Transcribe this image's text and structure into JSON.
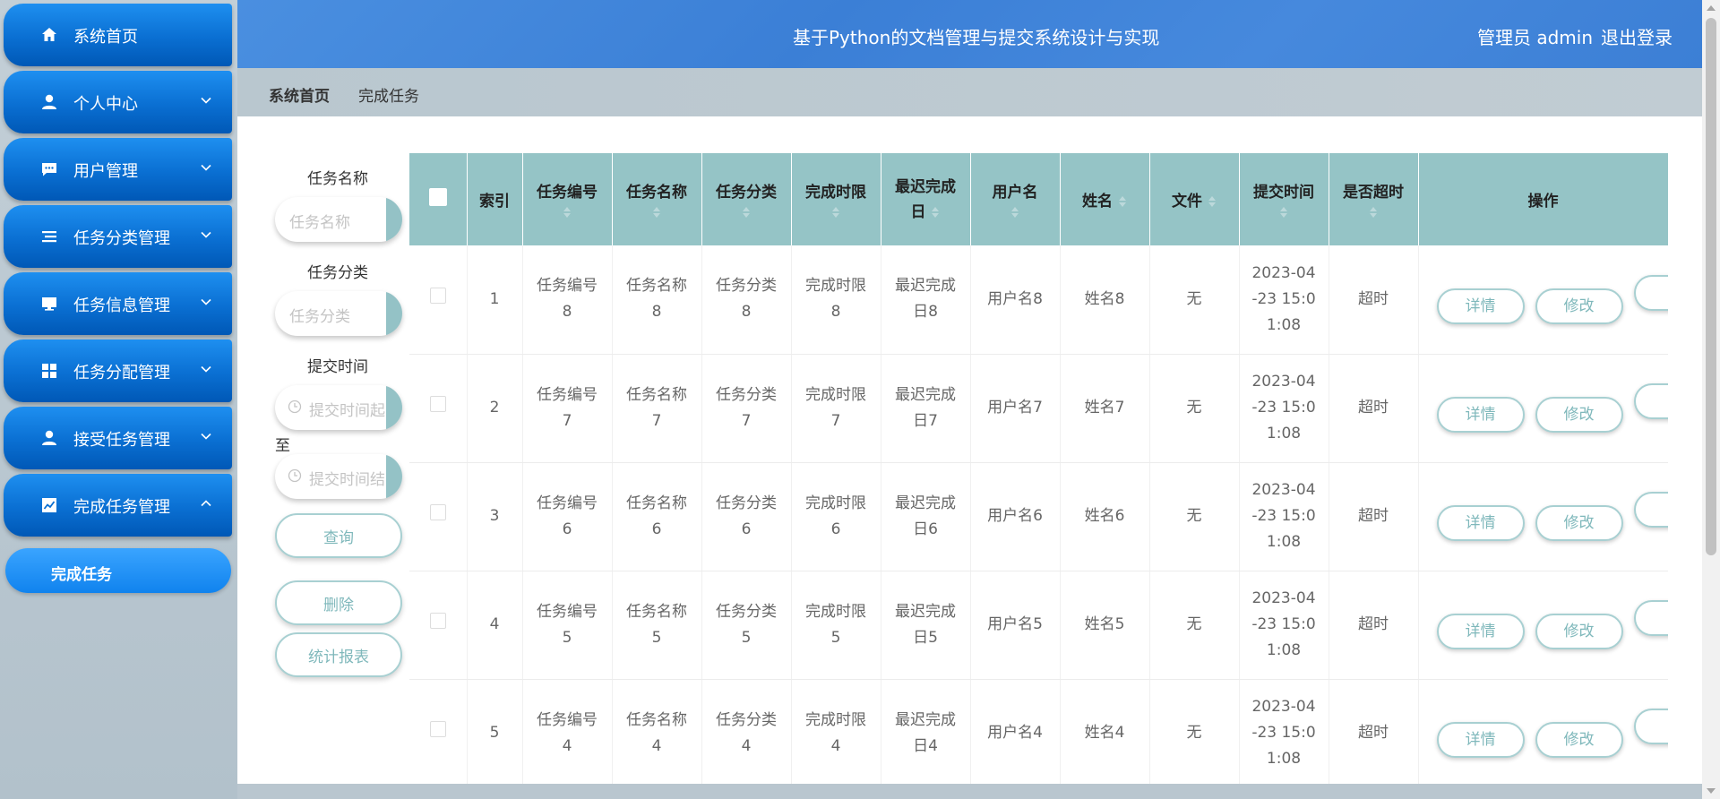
{
  "app": {
    "title": "基于Python的文档管理与提交系统设计与实现",
    "user_label": "管理员 admin",
    "logout_label": "退出登录"
  },
  "sidebar": {
    "items": [
      {
        "label": "系统首页",
        "icon": "home-icon",
        "has_chevron": false
      },
      {
        "label": "个人中心",
        "icon": "person-icon",
        "has_chevron": true
      },
      {
        "label": "用户管理",
        "icon": "chat-icon",
        "has_chevron": true
      },
      {
        "label": "任务分类管理",
        "icon": "list-icon",
        "has_chevron": true
      },
      {
        "label": "任务信息管理",
        "icon": "monitor-icon",
        "has_chevron": true
      },
      {
        "label": "任务分配管理",
        "icon": "grid-icon",
        "has_chevron": true
      },
      {
        "label": "接受任务管理",
        "icon": "person-icon",
        "has_chevron": true
      },
      {
        "label": "完成任务管理",
        "icon": "chart-icon",
        "has_chevron": true,
        "expanded": true
      }
    ],
    "sub_item": "完成任务"
  },
  "breadcrumb": {
    "home": "系统首页",
    "current": "完成任务"
  },
  "search": {
    "task_name_label": "任务名称",
    "task_name_placeholder": "任务名称",
    "task_category_label": "任务分类",
    "task_category_placeholder": "任务分类",
    "submit_time_label": "提交时间",
    "start_placeholder": "提交时间起",
    "to_label": "至",
    "end_placeholder": "提交时间结",
    "query_button": "查询",
    "delete_button": "删除",
    "report_button": "统计报表"
  },
  "table": {
    "headers": {
      "index": "索引",
      "task_no": "任务编号",
      "task_name": "任务名称",
      "task_category": "任务分类",
      "time_limit": "完成时限",
      "latest_l1": "最迟完成",
      "latest_l2": "日",
      "username": "用户名",
      "name": "姓名",
      "file": "文件",
      "submit_time": "提交时间",
      "overdue": "是否超时",
      "ops": "操作"
    },
    "rows": [
      {
        "index": "1",
        "task_no_l1": "任务编号",
        "task_no_l2": "8",
        "task_name_l1": "任务名称",
        "task_name_l2": "8",
        "cat_l1": "任务分类",
        "cat_l2": "8",
        "limit_l1": "完成时限",
        "limit_l2": "8",
        "latest_l1": "最迟完成",
        "latest_l2": "日8",
        "username": "用户名8",
        "name": "姓名8",
        "file": "无",
        "time_l1": "2023-04",
        "time_l2": "-23 15:0",
        "time_l3": "1:08",
        "overdue": "超时"
      },
      {
        "index": "2",
        "task_no_l1": "任务编号",
        "task_no_l2": "7",
        "task_name_l1": "任务名称",
        "task_name_l2": "7",
        "cat_l1": "任务分类",
        "cat_l2": "7",
        "limit_l1": "完成时限",
        "limit_l2": "7",
        "latest_l1": "最迟完成",
        "latest_l2": "日7",
        "username": "用户名7",
        "name": "姓名7",
        "file": "无",
        "time_l1": "2023-04",
        "time_l2": "-23 15:0",
        "time_l3": "1:08",
        "overdue": "超时"
      },
      {
        "index": "3",
        "task_no_l1": "任务编号",
        "task_no_l2": "6",
        "task_name_l1": "任务名称",
        "task_name_l2": "6",
        "cat_l1": "任务分类",
        "cat_l2": "6",
        "limit_l1": "完成时限",
        "limit_l2": "6",
        "latest_l1": "最迟完成",
        "latest_l2": "日6",
        "username": "用户名6",
        "name": "姓名6",
        "file": "无",
        "time_l1": "2023-04",
        "time_l2": "-23 15:0",
        "time_l3": "1:08",
        "overdue": "超时"
      },
      {
        "index": "4",
        "task_no_l1": "任务编号",
        "task_no_l2": "5",
        "task_name_l1": "任务名称",
        "task_name_l2": "5",
        "cat_l1": "任务分类",
        "cat_l2": "5",
        "limit_l1": "完成时限",
        "limit_l2": "5",
        "latest_l1": "最迟完成",
        "latest_l2": "日5",
        "username": "用户名5",
        "name": "姓名5",
        "file": "无",
        "time_l1": "2023-04",
        "time_l2": "-23 15:0",
        "time_l3": "1:08",
        "overdue": "超时"
      },
      {
        "index": "5",
        "task_no_l1": "任务编号",
        "task_no_l2": "4",
        "task_name_l1": "任务名称",
        "task_name_l2": "4",
        "cat_l1": "任务分类",
        "cat_l2": "4",
        "limit_l1": "完成时限",
        "limit_l2": "4",
        "latest_l1": "最迟完成",
        "latest_l2": "日4",
        "username": "用户名4",
        "name": "姓名4",
        "file": "无",
        "time_l1": "2023-04",
        "time_l2": "-23 15:0",
        "time_l3": "1:08",
        "overdue": "超时"
      }
    ],
    "row_buttons": {
      "detail": "详情",
      "edit": "修改"
    }
  },
  "colors": {
    "header_bg": "#3f83d9",
    "nav_bg": "#0a6fd2",
    "table_header_bg": "#95c4c6",
    "button_text": "#7fb8bb"
  }
}
